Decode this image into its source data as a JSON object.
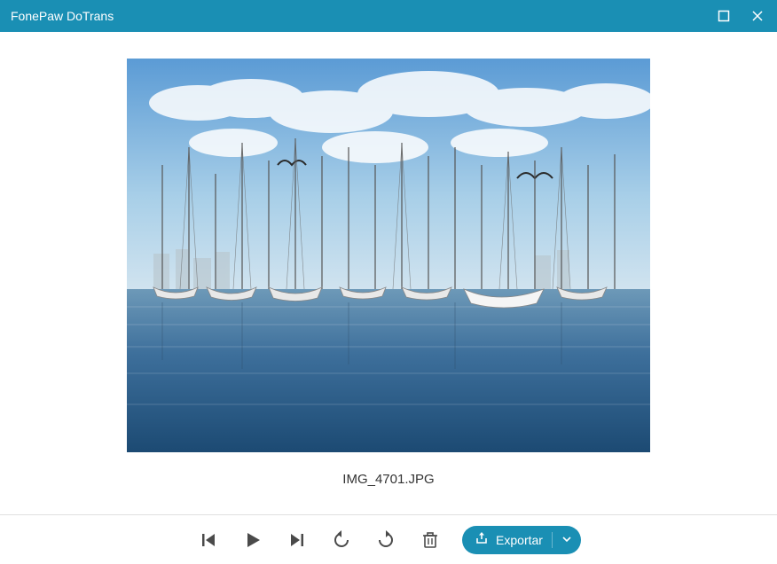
{
  "titlebar": {
    "title": "FonePaw DoTrans"
  },
  "image": {
    "caption": "IMG_4701.JPG",
    "description": "harbor with sailboats under blue sky with clouds"
  },
  "toolbar": {
    "first": "first-button",
    "play": "play-button",
    "last": "last-button",
    "rotate_ccw": "rotate-left-button",
    "rotate_cw": "rotate-right-button",
    "delete": "delete-button",
    "export_label": "Exportar"
  },
  "colors": {
    "accent": "#1a8fb4"
  }
}
